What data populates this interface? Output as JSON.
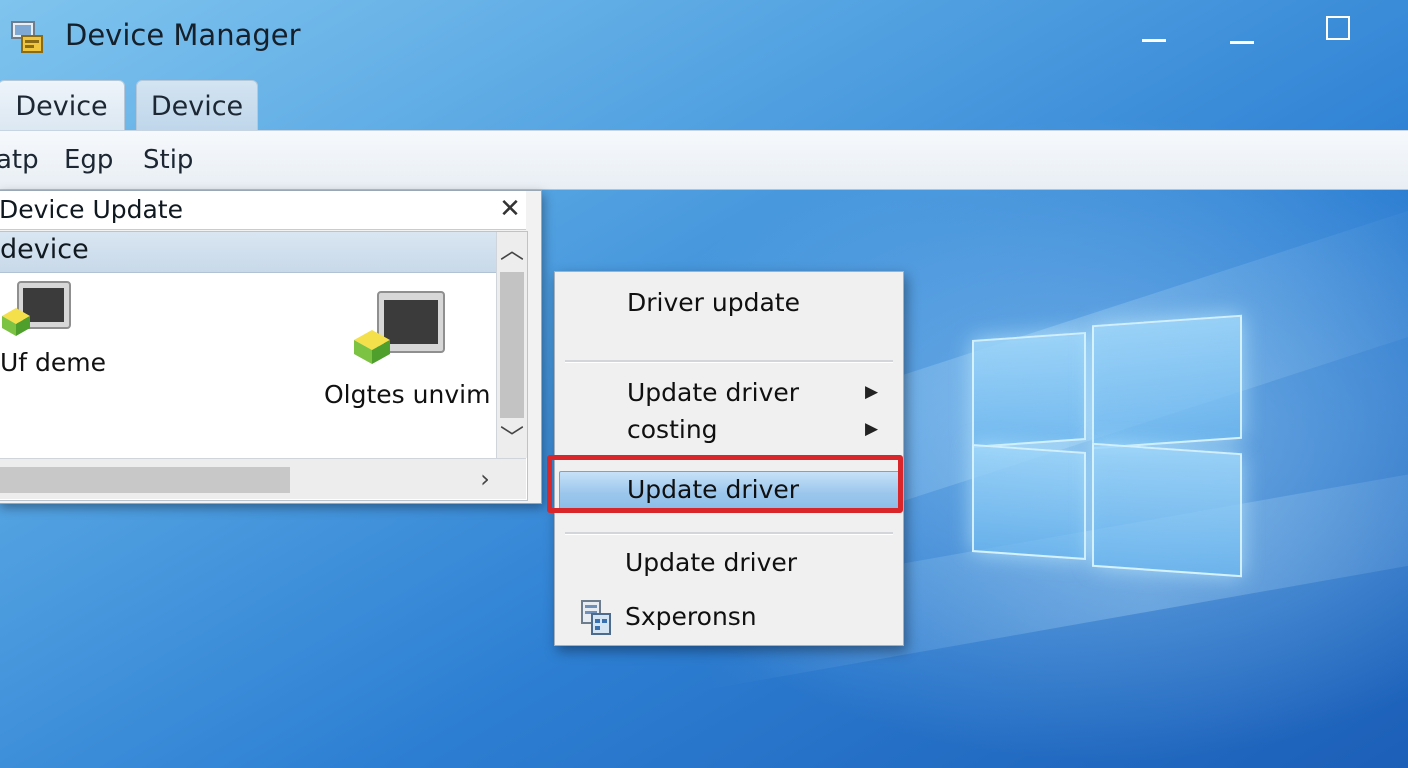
{
  "window": {
    "title": "Device Manager",
    "icon": "device-manager-icon"
  },
  "tabs": [
    {
      "label": "Device"
    },
    {
      "label": "Device"
    }
  ],
  "menubar": {
    "items": [
      {
        "label": "atp"
      },
      {
        "label": "Egp"
      },
      {
        "label": "Stip"
      }
    ]
  },
  "dialog": {
    "title": "Device Update",
    "list_header": "device",
    "devices": [
      {
        "label": "Uf deme",
        "icon": "network-adapter-icon"
      },
      {
        "label": "Olgtes unvim",
        "icon": "network-adapter-icon"
      }
    ]
  },
  "context_menu": {
    "items": [
      {
        "label": "Driver update"
      },
      {
        "label": "Update driver",
        "submenu": true
      },
      {
        "label": "costing",
        "submenu": true
      },
      {
        "label": "Update driver",
        "highlighted": true
      },
      {
        "label": "Update driver"
      },
      {
        "label": "Sxperonsn",
        "icon": "device-manager-icon"
      }
    ]
  },
  "colors": {
    "highlight_frame": "#d8262b",
    "menu_highlight": "#9cc7ec",
    "desktop_blue": "#2d7fd3"
  }
}
